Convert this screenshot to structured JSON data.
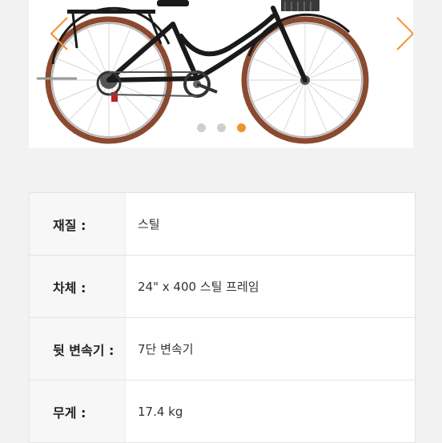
{
  "gallery": {
    "image_label": "bicycle",
    "pagination": {
      "count": 3,
      "active": 3
    },
    "prev_icon": "chevron-left-icon",
    "next_icon": "chevron-right-icon",
    "accent_color": "#f0932b",
    "tire_color": "#8b4a2f",
    "frame_color": "#1a1a1a"
  },
  "specs": [
    {
      "label": "재질 :",
      "value": "스틸"
    },
    {
      "label": "차체 :",
      "value": "24\" x 400 스틸 프레임"
    },
    {
      "label": "뒷 변속기 :",
      "value": "7단 변속기"
    },
    {
      "label": "무게 :",
      "value": "17.4 kg"
    }
  ]
}
